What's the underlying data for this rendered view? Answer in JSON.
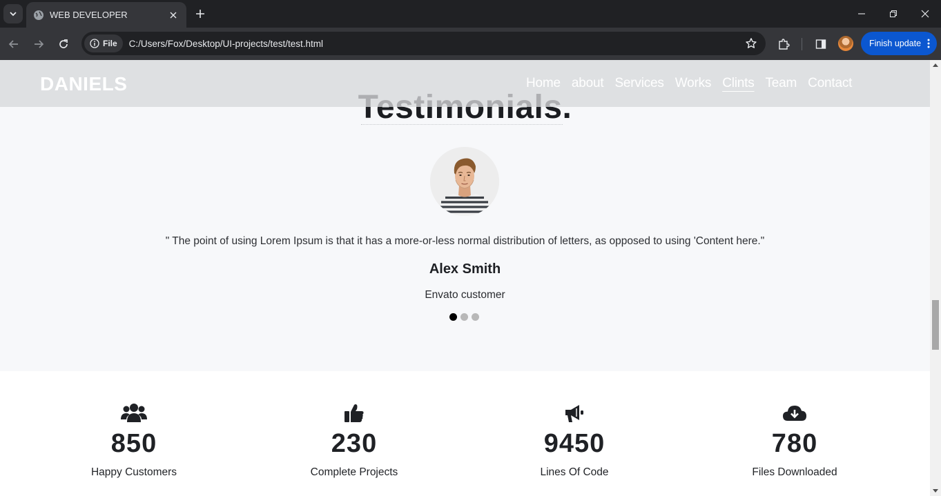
{
  "browser": {
    "tab_title": "WEB DEVELOPER",
    "site_chip_label": "File",
    "url": "C:/Users/Fox/Desktop/UI-projects/test/test.html",
    "update_button": "Finish update"
  },
  "header": {
    "logo": "DANIELS",
    "nav": [
      "Home",
      "about",
      "Services",
      "Works",
      "Clints",
      "Team",
      "Contact"
    ],
    "active_nav": "Clints"
  },
  "testimonials": {
    "title": "Testimonials.",
    "quote": "\" The point of using Lorem Ipsum is that it has a more-or-less normal distribution of letters, as opposed to using 'Content here.\"",
    "name": "Alex Smith",
    "role": "Envato customer",
    "slides_total": 3,
    "active_slide": 1
  },
  "stats": [
    {
      "icon": "users-icon",
      "number": "850",
      "label": "Happy Customers"
    },
    {
      "icon": "thumbs-up-icon",
      "number": "230",
      "label": "Complete Projects"
    },
    {
      "icon": "bullhorn-icon",
      "number": "9450",
      "label": "Lines Of Code"
    },
    {
      "icon": "cloud-download-icon",
      "number": "780",
      "label": "Files Downloaded"
    }
  ],
  "colors": {
    "browser_dark": "#202124",
    "browser_toolbar": "#35363a",
    "update_button": "#0b57d0",
    "section_bg": "#f7f8fa",
    "stats_bg": "#ffffff",
    "text_dark": "#1f2125"
  }
}
